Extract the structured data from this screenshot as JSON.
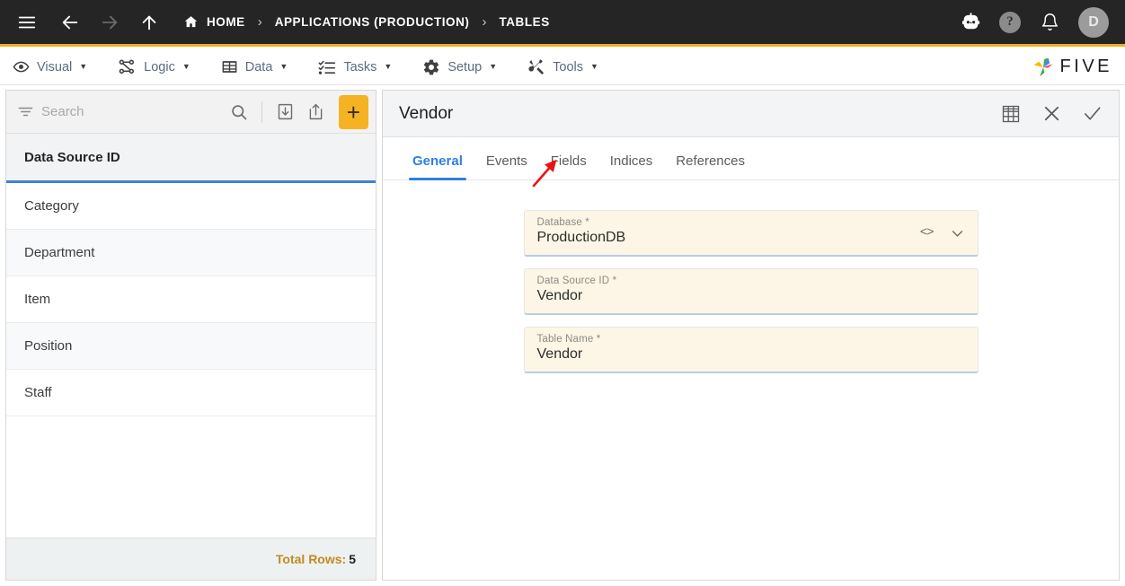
{
  "topbar": {
    "menu_icon": "hamburger-icon",
    "back_icon": "arrow-left-icon",
    "forward_icon": "arrow-right-icon",
    "up_icon": "arrow-up-icon",
    "breadcrumbs": [
      {
        "label": "HOME",
        "icon": "home-icon"
      },
      {
        "label": "APPLICATIONS (PRODUCTION)",
        "icon": ""
      },
      {
        "label": "TABLES",
        "icon": ""
      }
    ],
    "separator": "›",
    "robot_icon": "robot-icon",
    "help_label": "?",
    "bell_icon": "bell-icon",
    "avatar_initial": "D",
    "accent_color": "#f0ad25",
    "background_color": "#252525"
  },
  "menubar": {
    "items": [
      {
        "label": "Visual",
        "icon": "eye-icon",
        "caret": "▼"
      },
      {
        "label": "Logic",
        "icon": "flow-nodes-icon",
        "caret": "▼"
      },
      {
        "label": "Data",
        "icon": "table-grid-icon",
        "caret": "▼"
      },
      {
        "label": "Tasks",
        "icon": "checklist-icon",
        "caret": "▼"
      },
      {
        "label": "Setup",
        "icon": "gear-icon",
        "caret": "▼"
      },
      {
        "label": "Tools",
        "icon": "wrench-screwdriver-icon",
        "caret": "▼"
      }
    ],
    "brand": {
      "wordmark": "FIVE",
      "logo_icon": "five-pinwheel-logo",
      "logo_colors": [
        "#4285f4",
        "#ea4335",
        "#fbbc05",
        "#34a853"
      ]
    }
  },
  "sidebar": {
    "search": {
      "placeholder": "Search",
      "value": "",
      "filter_icon": "filter-icon",
      "search_icon": "search-icon",
      "import_icon": "import-download-icon",
      "export_icon": "export-upload-icon",
      "add_label": "+"
    },
    "column_header": "Data Source ID",
    "rows": [
      {
        "label": "Category"
      },
      {
        "label": "Department"
      },
      {
        "label": "Item"
      },
      {
        "label": "Position"
      },
      {
        "label": "Staff"
      }
    ],
    "footer": {
      "total_rows_label": "Total Rows:",
      "total_rows_value": "5"
    },
    "selected_row_accent": "#3c82d6"
  },
  "panel": {
    "title": "Vendor",
    "actions": [
      {
        "icon": "table-grid-icon",
        "name": "grid-view-button"
      },
      {
        "icon": "close-x-icon",
        "name": "close-button"
      },
      {
        "icon": "check-icon",
        "name": "confirm-button"
      }
    ],
    "tabs": [
      {
        "label": "General",
        "active": true
      },
      {
        "label": "Events",
        "active": false
      },
      {
        "label": "Fields",
        "active": false
      },
      {
        "label": "Indices",
        "active": false
      },
      {
        "label": "References",
        "active": false
      }
    ],
    "fields": [
      {
        "label": "Database *",
        "value": "ProductionDB",
        "has_code_icon": true,
        "has_chevron": true,
        "code_glyph": "<>",
        "chevron_glyph": "chevron-down-icon"
      },
      {
        "label": "Data Source ID *",
        "value": "Vendor",
        "has_code_icon": false,
        "has_chevron": false
      },
      {
        "label": "Table Name *",
        "value": "Vendor",
        "has_code_icon": false,
        "has_chevron": false
      }
    ],
    "field_bg_color": "#fdf6e6",
    "active_tab_color": "#2f7fe0"
  },
  "annotation": {
    "type": "red-arrow",
    "color": "#ee1111",
    "points_to": "Fields"
  }
}
